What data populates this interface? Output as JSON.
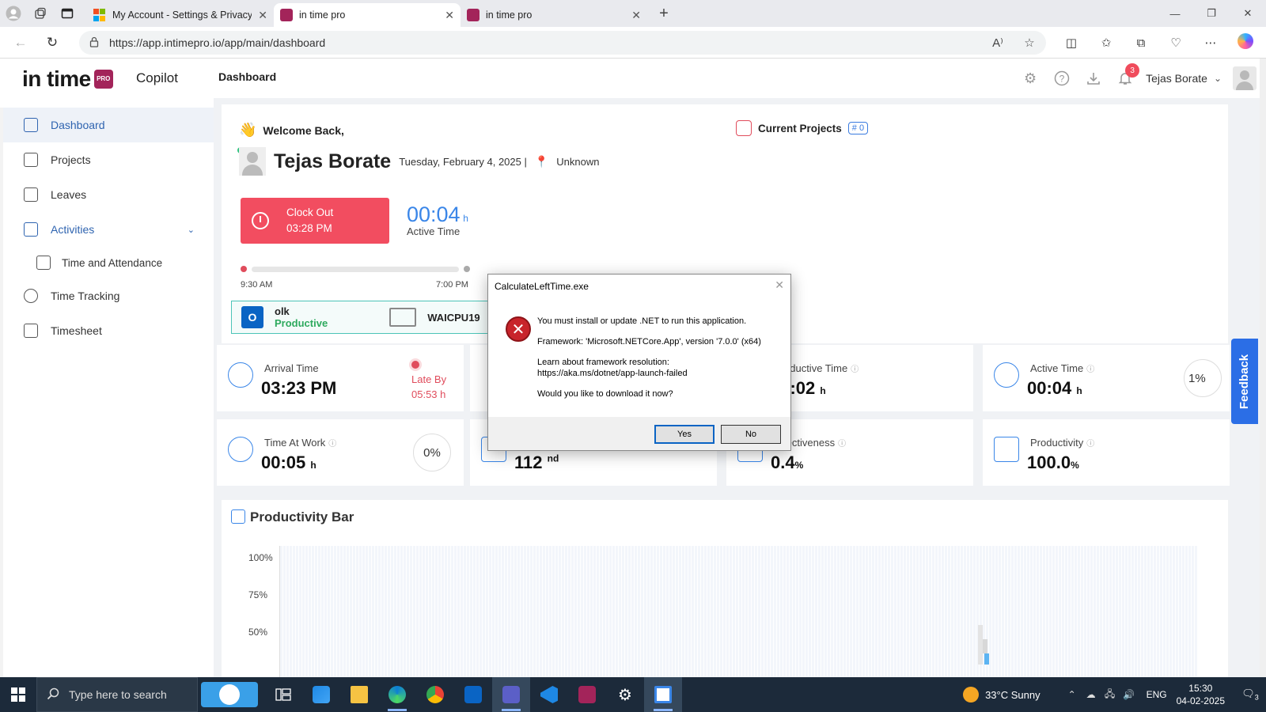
{
  "browser": {
    "tabs": [
      {
        "title": "My Account - Settings & Privacy",
        "active": false
      },
      {
        "title": "in time pro",
        "active": true
      },
      {
        "title": "in time pro",
        "active": false
      }
    ],
    "url": "https://app.intimepro.io/app/main/dashboard"
  },
  "header": {
    "logo_text": "in time",
    "logo_badge": "PRO",
    "product": "Copilot",
    "page_title": "Dashboard",
    "notification_count": "3",
    "user_name": "Tejas Borate"
  },
  "sidebar": {
    "items": [
      {
        "label": "Dashboard"
      },
      {
        "label": "Projects"
      },
      {
        "label": "Leaves"
      },
      {
        "label": "Activities"
      },
      {
        "label": "Time and Attendance"
      },
      {
        "label": "Time Tracking"
      },
      {
        "label": "Timesheet"
      }
    ]
  },
  "welcome": {
    "greeting": "Welcome Back,",
    "name": "Tejas Borate",
    "date": "Tuesday, February 4, 2025 |",
    "location": "Unknown",
    "current_projects_label": "Current Projects",
    "current_projects_count": "# 0",
    "clock_label": "Clock Out",
    "clock_time": "03:28 PM",
    "active_time_value": "00:04",
    "active_time_unit": "h",
    "active_time_label": "Active Time",
    "timeline_start": "9:30 AM",
    "timeline_end": "7:00 PM",
    "app_name": "olk",
    "app_status": "Productive",
    "app_icon_text": "O",
    "computer_name": "WAICPU19"
  },
  "stats": {
    "arrival_label": "Arrival Time",
    "arrival_value": "03:23 PM",
    "late_label": "Late By",
    "late_value": "05:53 h",
    "productive_label": "Productive Time",
    "productive_value": "00:02",
    "productive_unit": "h",
    "active_label": "Active Time",
    "active_value": "00:04",
    "active_unit": "h",
    "active_pct": "1%",
    "taw_label": "Time At Work",
    "taw_value": "00:05",
    "taw_unit": "h",
    "taw_pct": "0%",
    "place_value": "112",
    "place_suffix": "nd",
    "effectiveness_label": "Effectiveness",
    "effectiveness_value": "0.4",
    "effectiveness_unit": "%",
    "productivity_label": "Productivity",
    "productivity_value": "100.0",
    "productivity_unit": "%"
  },
  "productivity_bar": {
    "title": "Productivity Bar",
    "yticks": [
      "100%",
      "75%",
      "50%"
    ]
  },
  "feedback": "Feedback",
  "dialog": {
    "title": "CalculateLeftTime.exe",
    "line1": "You must install or update .NET to run this application.",
    "line2": "Framework: 'Microsoft.NETCore.App', version '7.0.0' (x64)",
    "line3": "Learn about framework resolution:",
    "line4": "https://aka.ms/dotnet/app-launch-failed",
    "line5": "Would you like to download it now?",
    "yes": "Yes",
    "no": "No"
  },
  "taskbar": {
    "search_placeholder": "Type here to search",
    "weather": "33°C  Sunny",
    "lang": "ENG",
    "time": "15:30",
    "date": "04-02-2025",
    "notifications": "3"
  }
}
